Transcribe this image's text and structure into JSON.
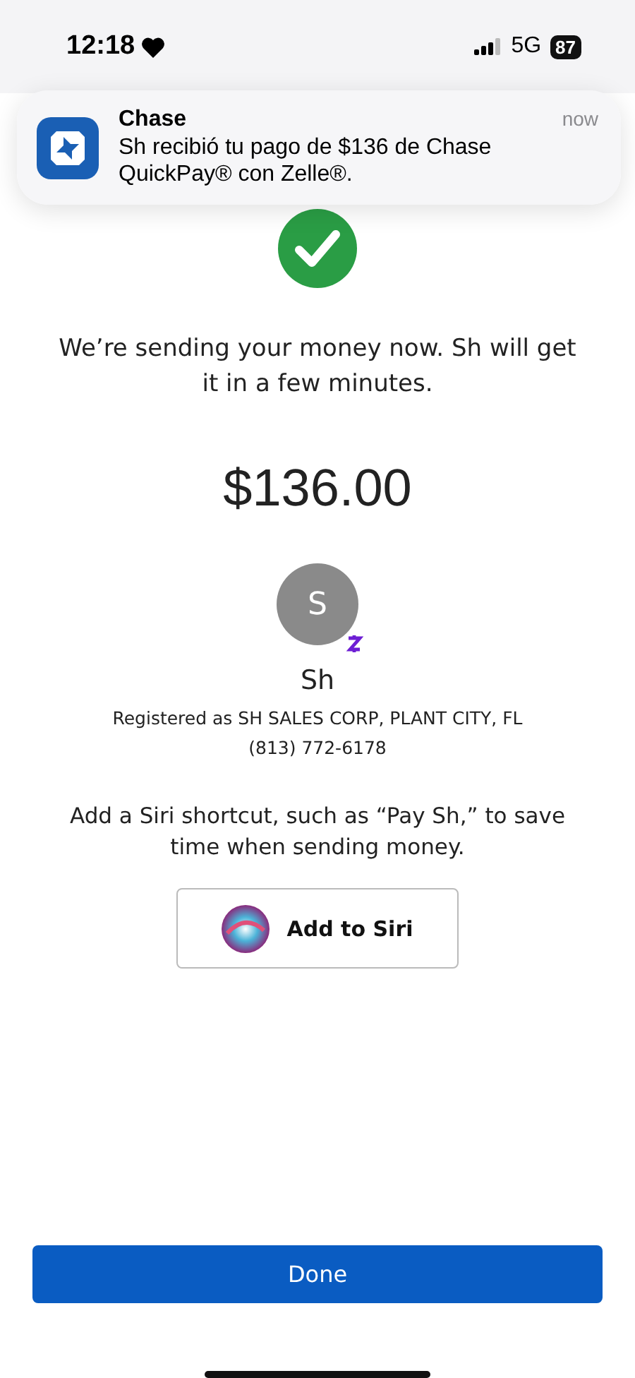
{
  "status_bar": {
    "time": "12:18",
    "network": "5G",
    "battery": "87"
  },
  "notification": {
    "app": "Chase",
    "time": "now",
    "message": "Sh recibió tu pago de $136 de Chase QuickPay® con Zelle®."
  },
  "confirmation": {
    "message": "We’re sending your money now. Sh will get it in a few minutes.",
    "amount": "$136.00"
  },
  "recipient": {
    "initial": "S",
    "name": "Sh",
    "registered": "Registered as SH SALES CORP, PLANT CITY, FL",
    "phone": "(813) 772-6178"
  },
  "siri": {
    "text": "Add a Siri shortcut, such as “Pay Sh,” to save time when sending money.",
    "button": "Add to Siri"
  },
  "done_button": "Done"
}
